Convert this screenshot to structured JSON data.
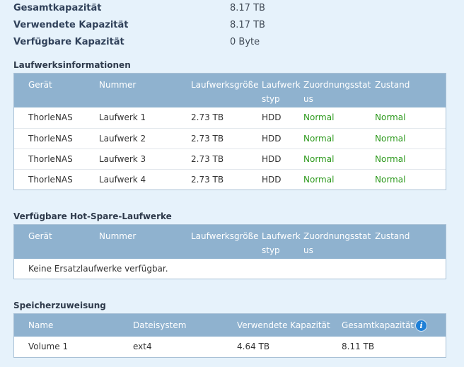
{
  "summary": {
    "total_label": "Gesamtkapazität",
    "total_value": "8.17 TB",
    "used_label": "Verwendete Kapazität",
    "used_value": "8.17 TB",
    "free_label": "Verfügbare Kapazität",
    "free_value": "0 Byte"
  },
  "drive_info": {
    "title": "Laufwerksinformationen",
    "headers": {
      "device": "Gerät",
      "number": "Nummer",
      "size": "Laufwerksgröße",
      "type": "Laufwerkstyp",
      "assignment": "Zuordnungsstatus",
      "health": "Zustand"
    },
    "rows": [
      {
        "device": "ThorleNAS",
        "number": "Laufwerk 1",
        "size": "2.73 TB",
        "type": "HDD",
        "assignment": "Normal",
        "health": "Normal"
      },
      {
        "device": "ThorleNAS",
        "number": "Laufwerk 2",
        "size": "2.73 TB",
        "type": "HDD",
        "assignment": "Normal",
        "health": "Normal"
      },
      {
        "device": "ThorleNAS",
        "number": "Laufwerk 3",
        "size": "2.73 TB",
        "type": "HDD",
        "assignment": "Normal",
        "health": "Normal"
      },
      {
        "device": "ThorleNAS",
        "number": "Laufwerk 4",
        "size": "2.73 TB",
        "type": "HDD",
        "assignment": "Normal",
        "health": "Normal"
      }
    ]
  },
  "hot_spare": {
    "title": "Verfügbare Hot-Spare-Laufwerke",
    "headers": {
      "device": "Gerät",
      "number": "Nummer",
      "size": "Laufwerksgröße",
      "type": "Laufwerkstyp",
      "assignment": "Zuordnungsstatus",
      "health": "Zustand"
    },
    "empty_text": "Keine Ersatzlaufwerke verfügbar."
  },
  "allocation": {
    "title": "Speicherzuweisung",
    "headers": {
      "name": "Name",
      "filesystem": "Dateisystem",
      "used": "Verwendete Kapazität",
      "total": "Gesamtkapazität"
    },
    "rows": [
      {
        "name": "Volume 1",
        "filesystem": "ext4",
        "used": "4.64 TB",
        "total": "8.11 TB"
      }
    ],
    "info_icon_glyph": "i"
  },
  "colors": {
    "background": "#e6f2fb",
    "header": "#8fb2cf",
    "status_ok": "#2e9a1e",
    "info_icon": "#1e7fd6"
  }
}
